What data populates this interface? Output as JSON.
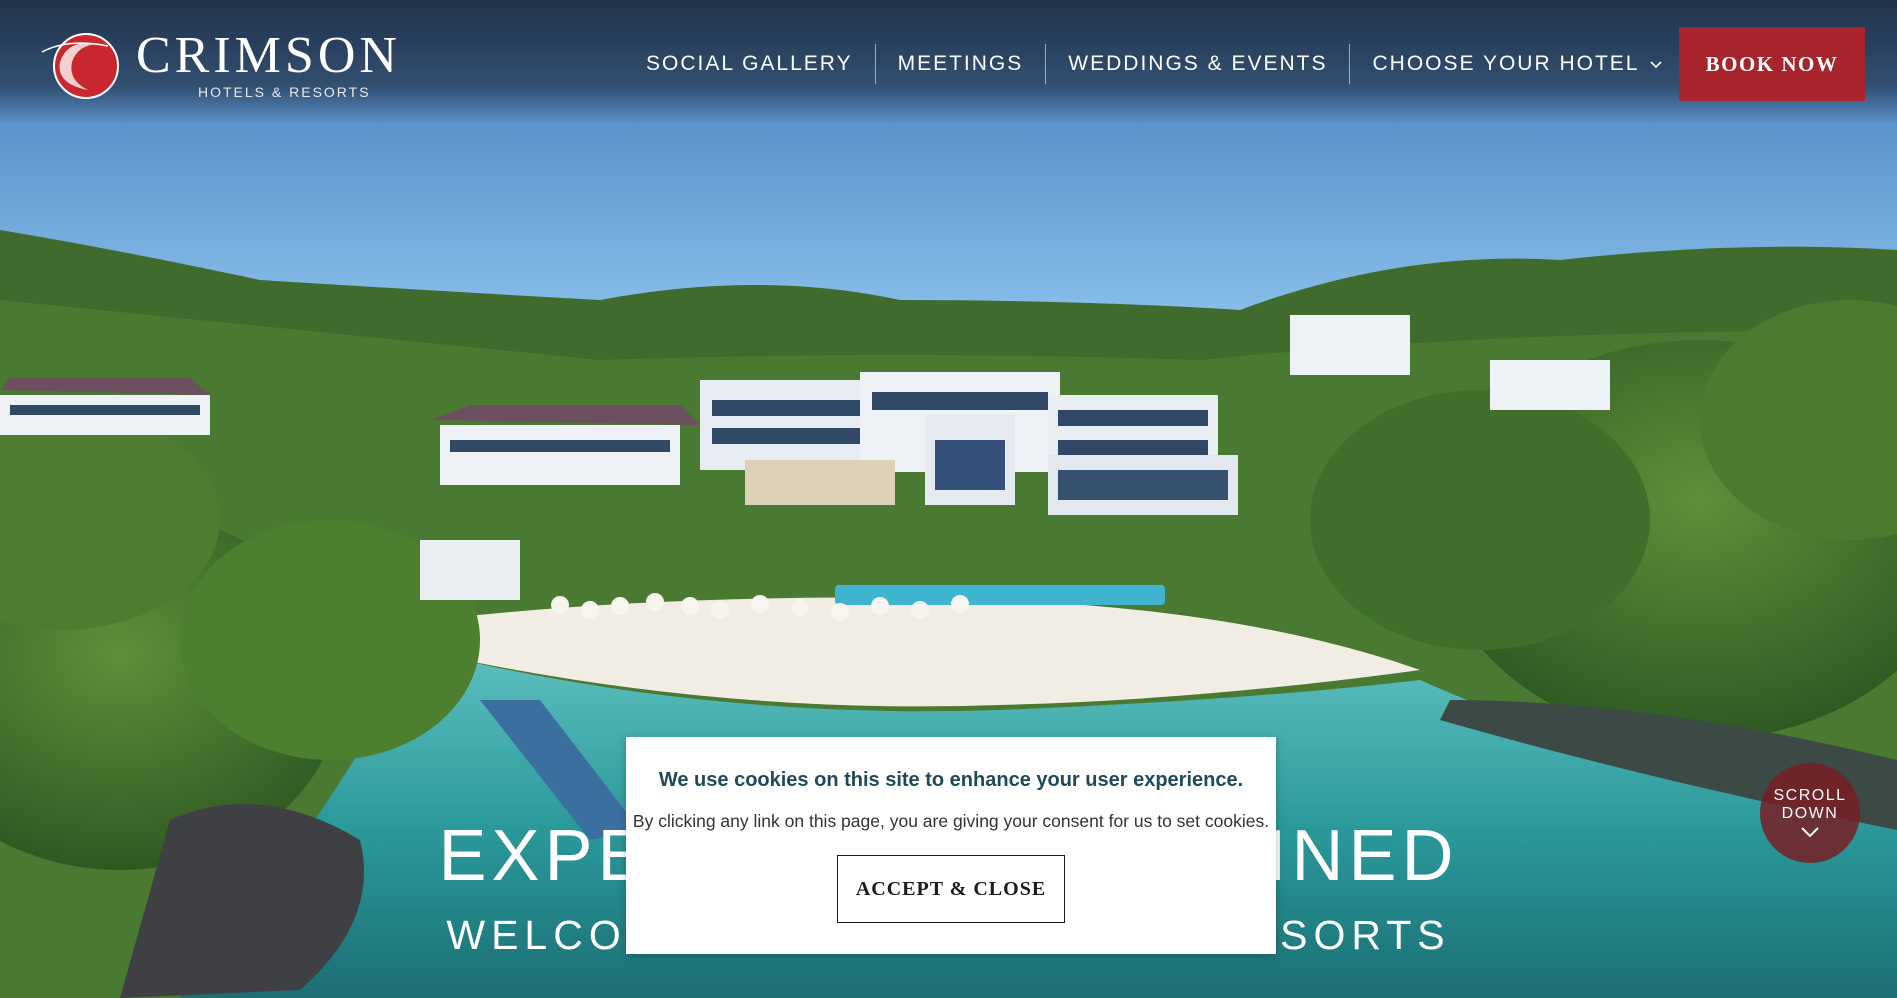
{
  "brand": {
    "name": "CRIMSON",
    "tagline": "HOTELS & RESORTS",
    "accent_color": "#a8252e"
  },
  "nav": {
    "items": [
      {
        "label": "SOCIAL GALLERY"
      },
      {
        "label": "MEETINGS"
      },
      {
        "label": "WEDDINGS & EVENTS"
      },
      {
        "label": "CHOOSE YOUR HOTEL"
      }
    ],
    "book_label": "BOOK NOW"
  },
  "hero": {
    "title_left": "EXPER",
    "title_right": "FINED",
    "subtitle_left": "WELCO",
    "subtitle_right": "ESORTS"
  },
  "scroll": {
    "line1": "SCROLL",
    "line2": "DOWN"
  },
  "cookie": {
    "title": "We use cookies on this site to enhance your user experience.",
    "text": "By clicking any link on this page, you are giving your consent for us to set cookies.",
    "button_label": "ACCEPT & CLOSE"
  }
}
